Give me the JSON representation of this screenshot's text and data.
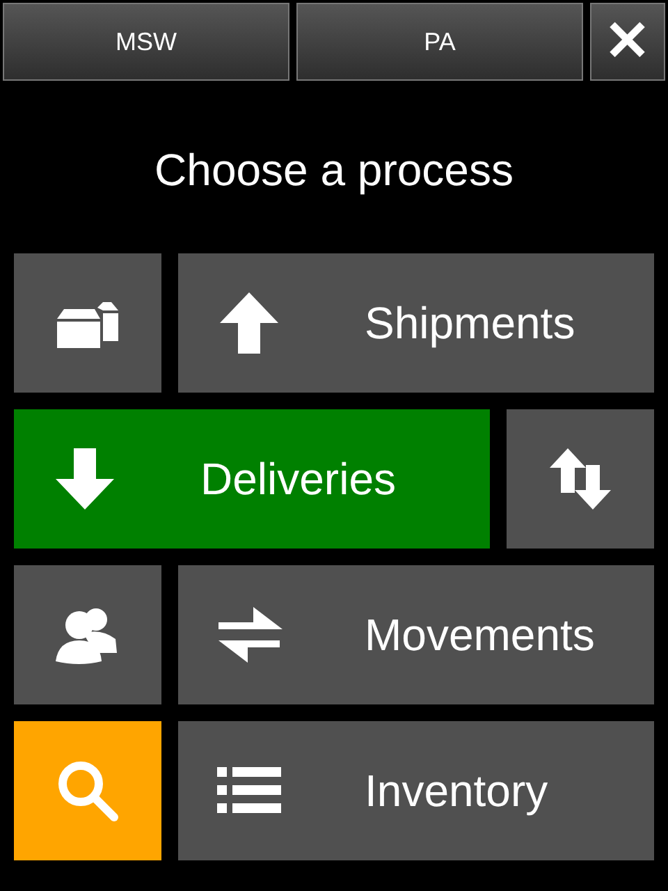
{
  "header": {
    "buttons": [
      "MSW",
      "PA"
    ],
    "close": "✕"
  },
  "title": "Choose a process",
  "rows": [
    {
      "tiles": [
        {
          "kind": "boxes",
          "color": "#505050"
        },
        {
          "kind": "up-arrow",
          "label": "Shipments",
          "color": "#505050"
        }
      ]
    },
    {
      "tiles": [
        {
          "kind": "down-arrow",
          "label": "Deliveries",
          "color": "#008000"
        },
        {
          "kind": "up-down-arrows",
          "color": "#505050"
        }
      ]
    },
    {
      "tiles": [
        {
          "kind": "people",
          "color": "#505050"
        },
        {
          "kind": "swap-arrows",
          "label": "Movements",
          "color": "#505050"
        }
      ]
    },
    {
      "tiles": [
        {
          "kind": "search",
          "color": "#ffa500"
        },
        {
          "kind": "list",
          "label": "Inventory",
          "color": "#505050"
        }
      ]
    }
  ]
}
